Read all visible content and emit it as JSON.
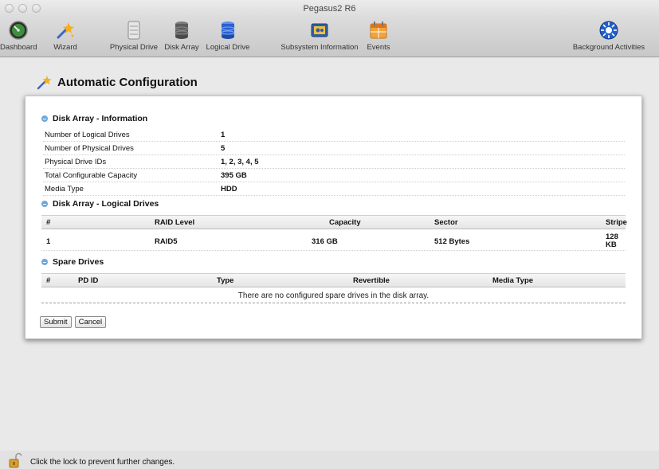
{
  "window": {
    "title": "Pegasus2 R6"
  },
  "toolbar": {
    "items": [
      {
        "label": "Dashboard",
        "icon": "dashboard-gauge-icon"
      },
      {
        "label": "Wizard",
        "icon": "wizard-wand-icon"
      },
      {
        "label": "Physical Drive",
        "icon": "physical-drive-icon"
      },
      {
        "label": "Disk Array",
        "icon": "disk-array-icon"
      },
      {
        "label": "Logical Drive",
        "icon": "logical-drive-icon"
      },
      {
        "label": "Subsystem Information",
        "icon": "subsystem-info-icon"
      },
      {
        "label": "Events",
        "icon": "events-calendar-icon"
      },
      {
        "label": "Background Activities",
        "icon": "background-activities-icon"
      }
    ]
  },
  "page": {
    "title": "Automatic Configuration"
  },
  "disk_array_info": {
    "heading": "Disk Array - Information",
    "rows": [
      {
        "key": "Number of Logical Drives",
        "value": "1"
      },
      {
        "key": "Number of Physical Drives",
        "value": "5"
      },
      {
        "key": "Physical Drive IDs",
        "value": "1, 2, 3, 4, 5"
      },
      {
        "key": "Total Configurable Capacity",
        "value": "395 GB"
      },
      {
        "key": "Media Type",
        "value": "HDD"
      }
    ]
  },
  "logical_drives": {
    "heading": "Disk Array - Logical Drives",
    "columns": [
      "#",
      "RAID Level",
      "Capacity",
      "Sector",
      "Stripe"
    ],
    "rows": [
      {
        "num": "1",
        "raid": "RAID5",
        "capacity": "316 GB",
        "sector": "512 Bytes",
        "stripe_line1": "128",
        "stripe_line2": "KB"
      }
    ]
  },
  "spare_drives": {
    "heading": "Spare Drives",
    "columns": [
      "#",
      "PD ID",
      "Type",
      "Revertible",
      "Media Type"
    ],
    "empty_message": "There are no configured spare drives in the disk array."
  },
  "buttons": {
    "submit": "Submit",
    "cancel": "Cancel"
  },
  "status": {
    "lock_text": "Click the lock to prevent further changes."
  },
  "colors": {
    "accent_blue": "#2a5fd0",
    "collapse_blue": "#6fa8d8"
  }
}
